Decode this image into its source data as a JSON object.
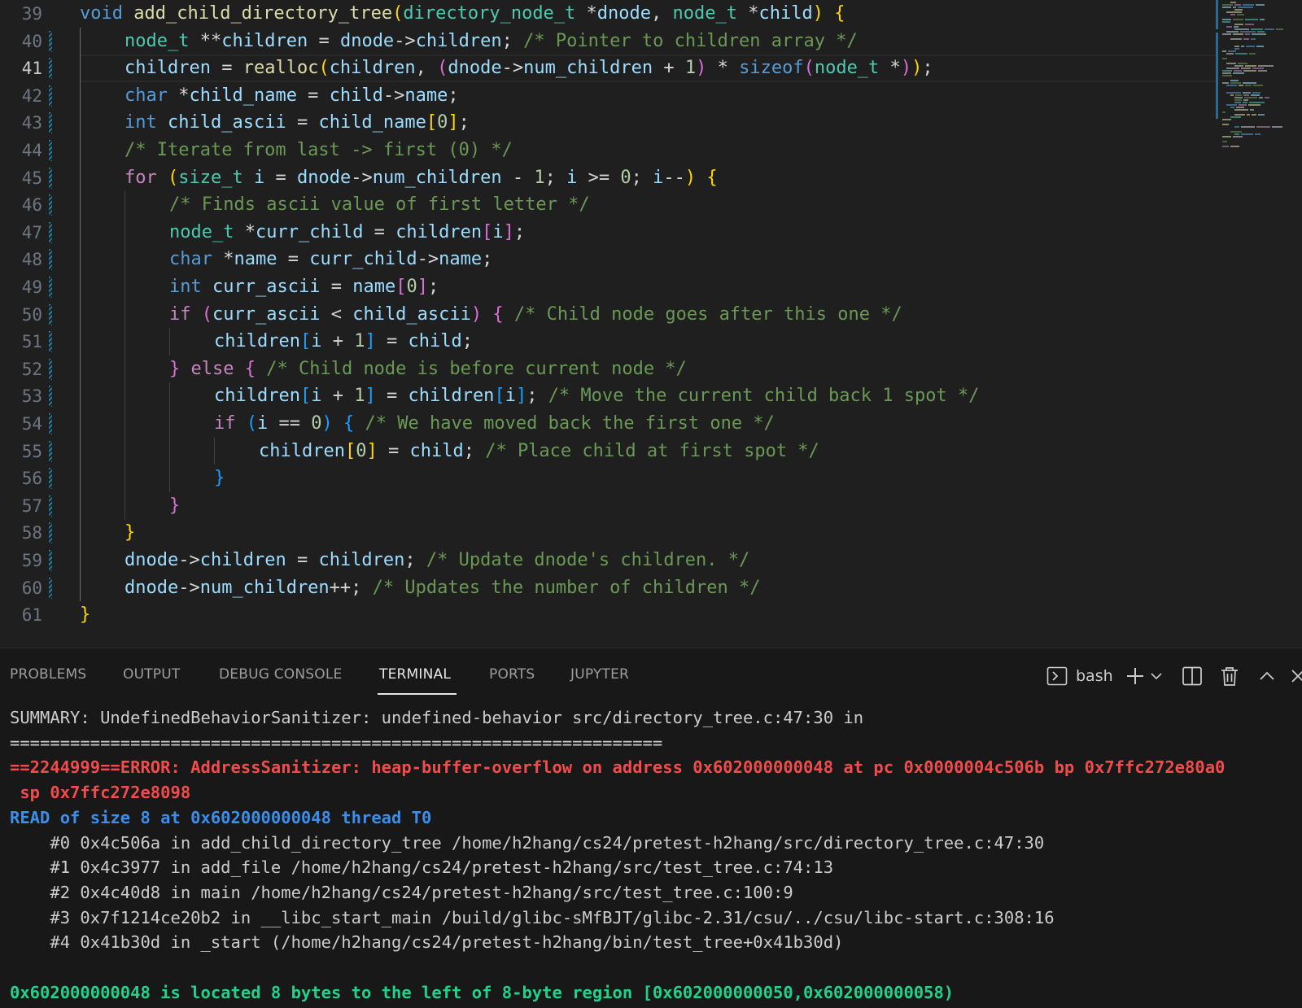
{
  "editor": {
    "current_line": 41,
    "lines": [
      {
        "n": "39",
        "indent": 0,
        "code": [
          [
            "kw",
            "void"
          ],
          [
            "op",
            " "
          ],
          [
            "fn",
            "add_child_directory_tree"
          ],
          [
            "b1",
            "("
          ],
          [
            "ty",
            "directory_node_t"
          ],
          [
            "op",
            " *"
          ],
          [
            "va",
            "dnode"
          ],
          [
            "op",
            ", "
          ],
          [
            "ty",
            "node_t"
          ],
          [
            "op",
            " *"
          ],
          [
            "va",
            "child"
          ],
          [
            "b1",
            ")"
          ],
          [
            "op",
            " "
          ],
          [
            "b1",
            "{"
          ]
        ]
      },
      {
        "n": "40",
        "indent": 1,
        "code": [
          [
            "ty",
            "node_t"
          ],
          [
            "op",
            " **"
          ],
          [
            "va",
            "children"
          ],
          [
            "op",
            " = "
          ],
          [
            "va",
            "dnode"
          ],
          [
            "op",
            "->"
          ],
          [
            "va",
            "children"
          ],
          [
            "op",
            "; "
          ],
          [
            "cm",
            "/* Pointer to children array */"
          ]
        ]
      },
      {
        "n": "41",
        "indent": 1,
        "code": [
          [
            "va",
            "children"
          ],
          [
            "op",
            " = "
          ],
          [
            "fn",
            "realloc"
          ],
          [
            "b1",
            "("
          ],
          [
            "va",
            "children"
          ],
          [
            "op",
            ", "
          ],
          [
            "b2",
            "("
          ],
          [
            "va",
            "dnode"
          ],
          [
            "op",
            "->"
          ],
          [
            "va",
            "num_children"
          ],
          [
            "op",
            " + "
          ],
          [
            "nu",
            "1"
          ],
          [
            "b2",
            ")"
          ],
          [
            "op",
            " * "
          ],
          [
            "kw",
            "sizeof"
          ],
          [
            "b2",
            "("
          ],
          [
            "ty",
            "node_t"
          ],
          [
            "op",
            " *"
          ],
          [
            "b2",
            ")"
          ],
          [
            "b1",
            ")"
          ],
          [
            "op",
            ";"
          ]
        ]
      },
      {
        "n": "42",
        "indent": 1,
        "code": [
          [
            "kw",
            "char"
          ],
          [
            "op",
            " *"
          ],
          [
            "va",
            "child_name"
          ],
          [
            "op",
            " = "
          ],
          [
            "va",
            "child"
          ],
          [
            "op",
            "->"
          ],
          [
            "va",
            "name"
          ],
          [
            "op",
            ";"
          ]
        ]
      },
      {
        "n": "43",
        "indent": 1,
        "code": [
          [
            "kw",
            "int"
          ],
          [
            "op",
            " "
          ],
          [
            "va",
            "child_ascii"
          ],
          [
            "op",
            " = "
          ],
          [
            "va",
            "child_name"
          ],
          [
            "b1",
            "["
          ],
          [
            "nu",
            "0"
          ],
          [
            "b1",
            "]"
          ],
          [
            "op",
            ";"
          ]
        ]
      },
      {
        "n": "44",
        "indent": 1,
        "code": [
          [
            "cm",
            "/* Iterate from last -> first (0) */"
          ]
        ]
      },
      {
        "n": "45",
        "indent": 1,
        "code": [
          [
            "kc",
            "for"
          ],
          [
            "op",
            " "
          ],
          [
            "b1",
            "("
          ],
          [
            "ty",
            "size_t"
          ],
          [
            "op",
            " "
          ],
          [
            "va",
            "i"
          ],
          [
            "op",
            " = "
          ],
          [
            "va",
            "dnode"
          ],
          [
            "op",
            "->"
          ],
          [
            "va",
            "num_children"
          ],
          [
            "op",
            " - "
          ],
          [
            "nu",
            "1"
          ],
          [
            "op",
            "; "
          ],
          [
            "va",
            "i"
          ],
          [
            "op",
            " >= "
          ],
          [
            "nu",
            "0"
          ],
          [
            "op",
            "; "
          ],
          [
            "va",
            "i"
          ],
          [
            "op",
            "--"
          ],
          [
            "b1",
            ")"
          ],
          [
            "op",
            " "
          ],
          [
            "b1",
            "{"
          ]
        ]
      },
      {
        "n": "46",
        "indent": 2,
        "code": [
          [
            "cm",
            "/* Finds ascii value of first letter */"
          ]
        ]
      },
      {
        "n": "47",
        "indent": 2,
        "code": [
          [
            "ty",
            "node_t"
          ],
          [
            "op",
            " *"
          ],
          [
            "va",
            "curr_child"
          ],
          [
            "op",
            " = "
          ],
          [
            "va",
            "children"
          ],
          [
            "b2",
            "["
          ],
          [
            "va",
            "i"
          ],
          [
            "b2",
            "]"
          ],
          [
            "op",
            ";"
          ]
        ]
      },
      {
        "n": "48",
        "indent": 2,
        "code": [
          [
            "kw",
            "char"
          ],
          [
            "op",
            " *"
          ],
          [
            "va",
            "name"
          ],
          [
            "op",
            " = "
          ],
          [
            "va",
            "curr_child"
          ],
          [
            "op",
            "->"
          ],
          [
            "va",
            "name"
          ],
          [
            "op",
            ";"
          ]
        ]
      },
      {
        "n": "49",
        "indent": 2,
        "code": [
          [
            "kw",
            "int"
          ],
          [
            "op",
            " "
          ],
          [
            "va",
            "curr_ascii"
          ],
          [
            "op",
            " = "
          ],
          [
            "va",
            "name"
          ],
          [
            "b2",
            "["
          ],
          [
            "nu",
            "0"
          ],
          [
            "b2",
            "]"
          ],
          [
            "op",
            ";"
          ]
        ]
      },
      {
        "n": "50",
        "indent": 2,
        "code": [
          [
            "kc",
            "if"
          ],
          [
            "op",
            " "
          ],
          [
            "b2",
            "("
          ],
          [
            "va",
            "curr_ascii"
          ],
          [
            "op",
            " < "
          ],
          [
            "va",
            "child_ascii"
          ],
          [
            "b2",
            ")"
          ],
          [
            "op",
            " "
          ],
          [
            "b2",
            "{"
          ],
          [
            "op",
            " "
          ],
          [
            "cm",
            "/* Child node goes after this one */"
          ]
        ]
      },
      {
        "n": "51",
        "indent": 3,
        "code": [
          [
            "va",
            "children"
          ],
          [
            "b3",
            "["
          ],
          [
            "va",
            "i"
          ],
          [
            "op",
            " + "
          ],
          [
            "nu",
            "1"
          ],
          [
            "b3",
            "]"
          ],
          [
            "op",
            " = "
          ],
          [
            "va",
            "child"
          ],
          [
            "op",
            ";"
          ]
        ]
      },
      {
        "n": "52",
        "indent": 2,
        "code": [
          [
            "b2",
            "}"
          ],
          [
            "op",
            " "
          ],
          [
            "kc",
            "else"
          ],
          [
            "op",
            " "
          ],
          [
            "b2",
            "{"
          ],
          [
            "op",
            " "
          ],
          [
            "cm",
            "/* Child node is before current node */"
          ]
        ]
      },
      {
        "n": "53",
        "indent": 3,
        "code": [
          [
            "va",
            "children"
          ],
          [
            "b3",
            "["
          ],
          [
            "va",
            "i"
          ],
          [
            "op",
            " + "
          ],
          [
            "nu",
            "1"
          ],
          [
            "b3",
            "]"
          ],
          [
            "op",
            " = "
          ],
          [
            "va",
            "children"
          ],
          [
            "b3",
            "["
          ],
          [
            "va",
            "i"
          ],
          [
            "b3",
            "]"
          ],
          [
            "op",
            "; "
          ],
          [
            "cm",
            "/* Move the current child back 1 spot */"
          ]
        ]
      },
      {
        "n": "54",
        "indent": 3,
        "code": [
          [
            "kc",
            "if"
          ],
          [
            "op",
            " "
          ],
          [
            "b3",
            "("
          ],
          [
            "va",
            "i"
          ],
          [
            "op",
            " == "
          ],
          [
            "nu",
            "0"
          ],
          [
            "b3",
            ")"
          ],
          [
            "op",
            " "
          ],
          [
            "b3",
            "{"
          ],
          [
            "op",
            " "
          ],
          [
            "cm",
            "/* We have moved back the first one */"
          ]
        ]
      },
      {
        "n": "55",
        "indent": 4,
        "code": [
          [
            "va",
            "children"
          ],
          [
            "b1",
            "["
          ],
          [
            "nu",
            "0"
          ],
          [
            "b1",
            "]"
          ],
          [
            "op",
            " = "
          ],
          [
            "va",
            "child"
          ],
          [
            "op",
            "; "
          ],
          [
            "cm",
            "/* Place child at first spot */"
          ]
        ]
      },
      {
        "n": "56",
        "indent": 3,
        "code": [
          [
            "b3",
            "}"
          ]
        ]
      },
      {
        "n": "57",
        "indent": 2,
        "code": [
          [
            "b2",
            "}"
          ]
        ]
      },
      {
        "n": "58",
        "indent": 1,
        "code": [
          [
            "b1",
            "}"
          ]
        ]
      },
      {
        "n": "59",
        "indent": 1,
        "code": [
          [
            "va",
            "dnode"
          ],
          [
            "op",
            "->"
          ],
          [
            "va",
            "children"
          ],
          [
            "op",
            " = "
          ],
          [
            "va",
            "children"
          ],
          [
            "op",
            "; "
          ],
          [
            "cm",
            "/* Update dnode's children. */"
          ]
        ]
      },
      {
        "n": "60",
        "indent": 1,
        "code": [
          [
            "va",
            "dnode"
          ],
          [
            "op",
            "->"
          ],
          [
            "va",
            "num_children"
          ],
          [
            "op",
            "++; "
          ],
          [
            "cm",
            "/* Updates the number of children */"
          ]
        ]
      },
      {
        "n": "61",
        "indent": 0,
        "code": [
          [
            "b1",
            "}"
          ]
        ]
      }
    ]
  },
  "panel": {
    "tabs": [
      {
        "label": "PROBLEMS",
        "active": false
      },
      {
        "label": "OUTPUT",
        "active": false
      },
      {
        "label": "DEBUG CONSOLE",
        "active": false
      },
      {
        "label": "TERMINAL",
        "active": true
      },
      {
        "label": "PORTS",
        "active": false
      },
      {
        "label": "JUPYTER",
        "active": false
      }
    ],
    "actions": {
      "terminal_shell": "bash",
      "terminal_icon": "terminal-icon",
      "new_icon": "plus-icon",
      "dropdown_icon": "chevron-down-icon",
      "split_icon": "split-editor-icon",
      "kill_icon": "trash-icon",
      "maximize_icon": "chevron-up-icon",
      "close_icon": "close-icon"
    }
  },
  "terminal": {
    "lines": [
      {
        "style": "normal",
        "text": "SUMMARY: UndefinedBehaviorSanitizer: undefined-behavior src/directory_tree.c:47:30 in"
      },
      {
        "style": "normal",
        "text": "================================================================="
      },
      {
        "style": "err",
        "text": "==2244999==ERROR: AddressSanitizer: heap-buffer-overflow on address 0x602000000048 at pc 0x0000004c506b bp 0x7ffc272e80a0"
      },
      {
        "style": "err",
        "text": " sp 0x7ffc272e8098"
      },
      {
        "style": "blue",
        "text": "READ of size 8 at 0x602000000048 thread T0"
      },
      {
        "style": "normal",
        "text": "    #0 0x4c506a in add_child_directory_tree /home/h2hang/cs24/pretest-h2hang/src/directory_tree.c:47:30"
      },
      {
        "style": "normal",
        "text": "    #1 0x4c3977 in add_file /home/h2hang/cs24/pretest-h2hang/src/test_tree.c:74:13"
      },
      {
        "style": "normal",
        "text": "    #2 0x4c40d8 in main /home/h2hang/cs24/pretest-h2hang/src/test_tree.c:100:9"
      },
      {
        "style": "normal",
        "text": "    #3 0x7f1214ce20b2 in __libc_start_main /build/glibc-sMfBJT/glibc-2.31/csu/../csu/libc-start.c:308:16"
      },
      {
        "style": "normal",
        "text": "    #4 0x41b30d in _start (/home/h2hang/cs24/pretest-h2hang/bin/test_tree+0x41b30d)"
      },
      {
        "style": "normal",
        "text": ""
      },
      {
        "style": "green",
        "text": "0x602000000048 is located 8 bytes to the left of 8-byte region [0x602000000050,0x602000000058)"
      }
    ]
  }
}
